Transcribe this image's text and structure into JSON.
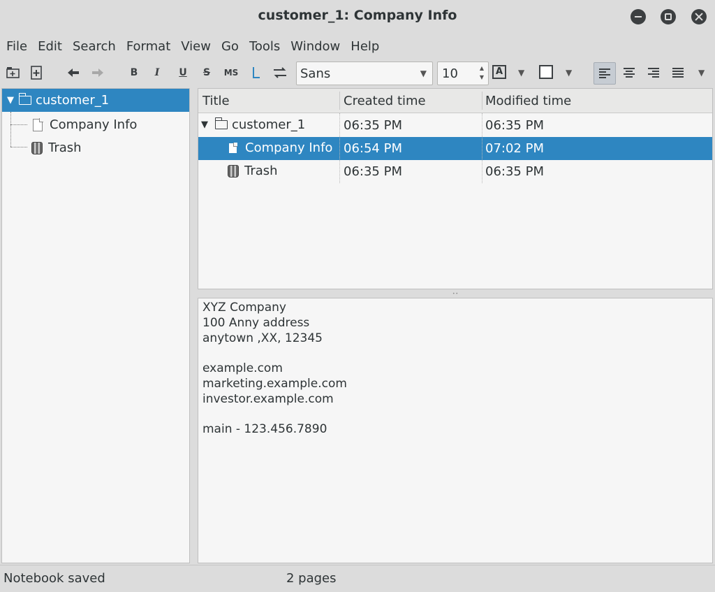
{
  "window": {
    "title": "customer_1: Company Info"
  },
  "menubar": [
    "File",
    "Edit",
    "Search",
    "Format",
    "View",
    "Go",
    "Tools",
    "Window",
    "Help"
  ],
  "toolbar": {
    "bold": "B",
    "italic": "I",
    "underline": "U",
    "strikethrough": "S",
    "monospace": "MS",
    "font_name": "Sans",
    "font_size": "10",
    "text_color_label": "A"
  },
  "tree": {
    "notebook": "customer_1",
    "children": [
      {
        "label": "Company Info",
        "icon": "page-icon"
      },
      {
        "label": "Trash",
        "icon": "trash-icon"
      }
    ]
  },
  "list": {
    "columns": [
      "Title",
      "Created time",
      "Modified time"
    ],
    "rows": [
      {
        "title": "customer_1",
        "created": "06:35 PM",
        "modified": "06:35 PM"
      },
      {
        "title": "Company Info",
        "created": "06:54 PM",
        "modified": "07:02 PM"
      },
      {
        "title": "Trash",
        "created": "06:35 PM",
        "modified": "06:35 PM"
      }
    ]
  },
  "editor": {
    "lines": [
      "XYZ Company",
      "100 Anny address",
      "anytown ,XX, 12345",
      "",
      "example.com",
      "marketing.example.com",
      "investor.example.com",
      "",
      "main - 123.456.7890"
    ]
  },
  "status": {
    "message": "Notebook saved",
    "pages": "2 pages"
  },
  "colors": {
    "selection": "#2e86c1",
    "window_bg": "#dcdcdc",
    "pane_bg": "#f6f6f6"
  }
}
